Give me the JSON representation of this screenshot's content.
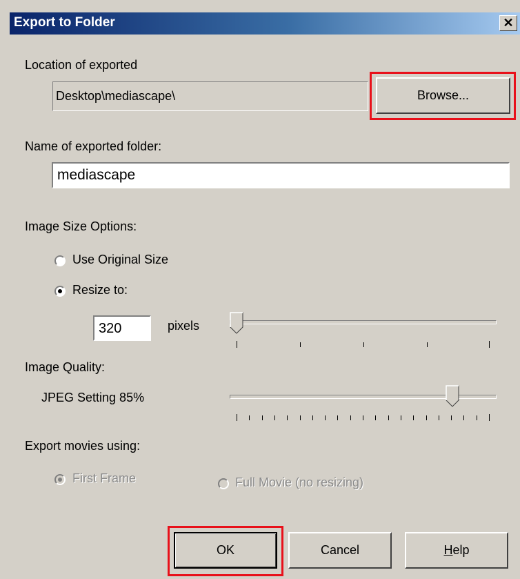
{
  "window": {
    "title": "Export to Folder",
    "close_label": "x"
  },
  "location": {
    "label": "Location of exported",
    "path": "Desktop\\mediascape\\",
    "browse_label": "Browse..."
  },
  "folder": {
    "label": "Name of exported folder:",
    "value": "mediascape"
  },
  "image_size": {
    "label": "Image Size Options:",
    "option_original": "Use Original Size",
    "option_resize": "Resize to:",
    "selected": "resize",
    "width_value": "320",
    "unit": "pixels",
    "slider_fraction": 0.0
  },
  "quality": {
    "label": "Image Quality:",
    "setting_text": "JPEG Setting 85%",
    "percent": 85
  },
  "movies": {
    "label": "Export movies using:",
    "option_first": "First Frame",
    "option_full": "Full Movie (no resizing)",
    "selected": "first",
    "enabled": false
  },
  "buttons": {
    "ok": "OK",
    "cancel": "Cancel",
    "help_prefix": "H",
    "help_rest": "elp"
  },
  "colors": {
    "highlight": "#e8101a",
    "title_start": "#0a246a",
    "title_end": "#a6caf0",
    "face": "#d4d0c8"
  }
}
